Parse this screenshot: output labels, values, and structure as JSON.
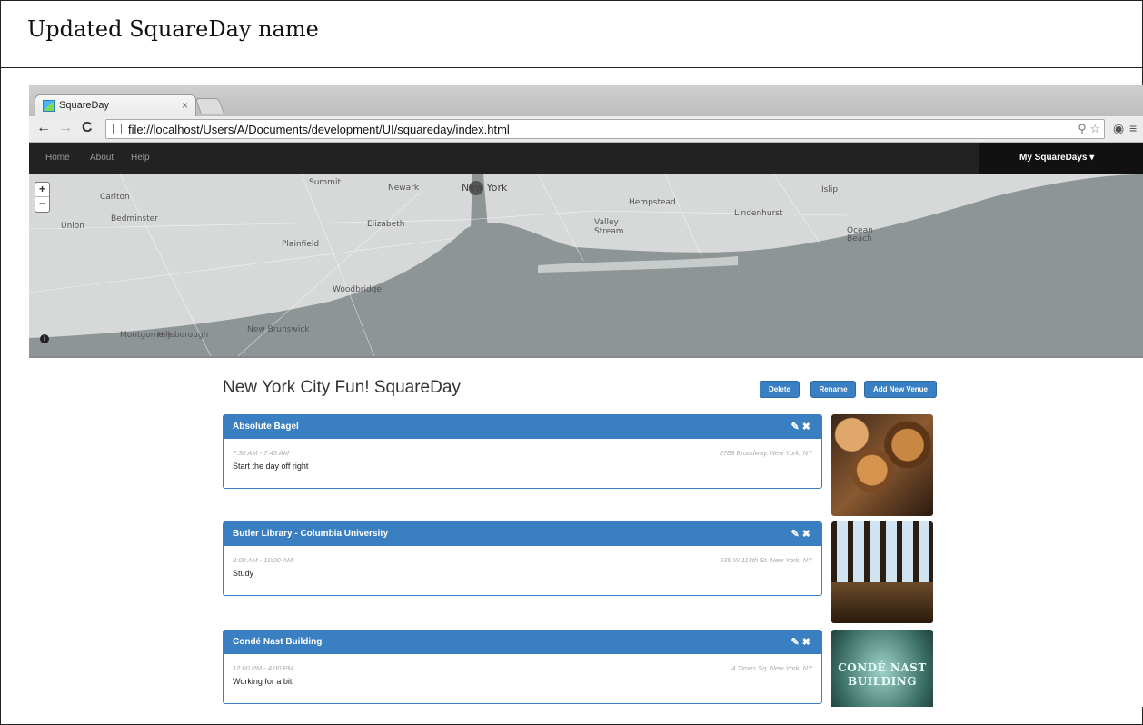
{
  "caption": "Updated SquareDay name",
  "browser": {
    "tab_title": "SquareDay",
    "tab_close": "×",
    "url": "file://localhost/Users/A/Documents/development/UI/squareday/index.html"
  },
  "nav": {
    "links": [
      "Home",
      "About",
      "Help"
    ],
    "right_menu": "My SquareDays ▾"
  },
  "map": {
    "zoom_in": "+",
    "zoom_out": "−",
    "labels": [
      "Summit",
      "Newark",
      "New York",
      "Hempstead",
      "Islip",
      "Lindenhurst",
      "Valley Stream",
      "Elizabeth",
      "Bedminster",
      "Union",
      "Plainfield",
      "Woodbridge",
      "New Brunswick",
      "Montgomery",
      "Hillsborough",
      "Ocean Beach",
      "Carlton"
    ]
  },
  "page": {
    "title": "New York City Fun! SquareDay",
    "buttons": {
      "delete": "Delete",
      "rename": "Rename",
      "add": "Add New Venue"
    }
  },
  "venues": [
    {
      "name": "Absolute Bagel",
      "time": "7:30 AM - 7:45 AM",
      "address": "2788 Broadway. New York, NY",
      "desc": "Start the day off right"
    },
    {
      "name": "Butler Library - Columbia University",
      "time": "8:00 AM - 10:00 AM",
      "address": "535 W 114th St. New York, NY",
      "desc": "Study"
    },
    {
      "name": "Condé Nast Building",
      "time": "12:00 PM - 4:00 PM",
      "address": "4 Times Sq. New York, NY",
      "desc": "Working for a bit."
    }
  ],
  "photo_text": {
    "conde_line1": "CONDÉ NAST",
    "conde_line2": "BUILDING"
  },
  "colors": {
    "primary": "#3a7fc1",
    "navbar": "#222222",
    "water": "#8e9597",
    "land": "#d6d9d8"
  },
  "icons": {
    "edit": "pencil-icon",
    "remove": "x-icon",
    "reload": "reload-icon",
    "star": "star-icon"
  }
}
